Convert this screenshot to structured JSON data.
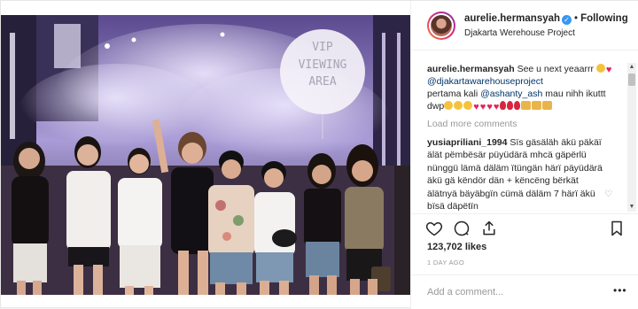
{
  "post": {
    "username": "aurelie.hermansyah",
    "follow_label": "Following",
    "location": "Djakarta Werehouse Project",
    "photo_sign": [
      "VIP",
      "VIEWING",
      "AREA"
    ]
  },
  "caption": {
    "username": "aurelie.hermansyah",
    "text_1": "See u next yeaarrr",
    "mention_1": "@djakartawarehouseproject",
    "text_2": "pertama kali",
    "mention_2": "@ashanty_ash",
    "text_3": "mau nihh ikuttt dwp"
  },
  "load_more_label": "Load more comments",
  "comment": {
    "username": "yusiapriliani_1994",
    "text": "Sïs gäsäläh äkü päkäï älät pëmbësär püyüdärä mhcä gäpërlü nünggü lämä däläm ïtüngän härï päyüdärä äkü gä këndör dän + këncëng bërkät älätnyä bäyäbgïn cümä däläm 7 härï äkü bïsä däpëtïn"
  },
  "likes_label": "123,702 likes",
  "time_ago": "1 DAY AGO",
  "add_comment": {
    "placeholder": "Add a comment..."
  },
  "icons": {
    "verified": "verified-badge-icon",
    "heart": "heart-icon",
    "comment": "comment-icon",
    "share": "share-icon",
    "save": "bookmark-icon",
    "more": "more-options-icon"
  },
  "colors": {
    "link": "#003569",
    "verified": "#3897f0",
    "muted": "#999999",
    "text": "#262626"
  }
}
